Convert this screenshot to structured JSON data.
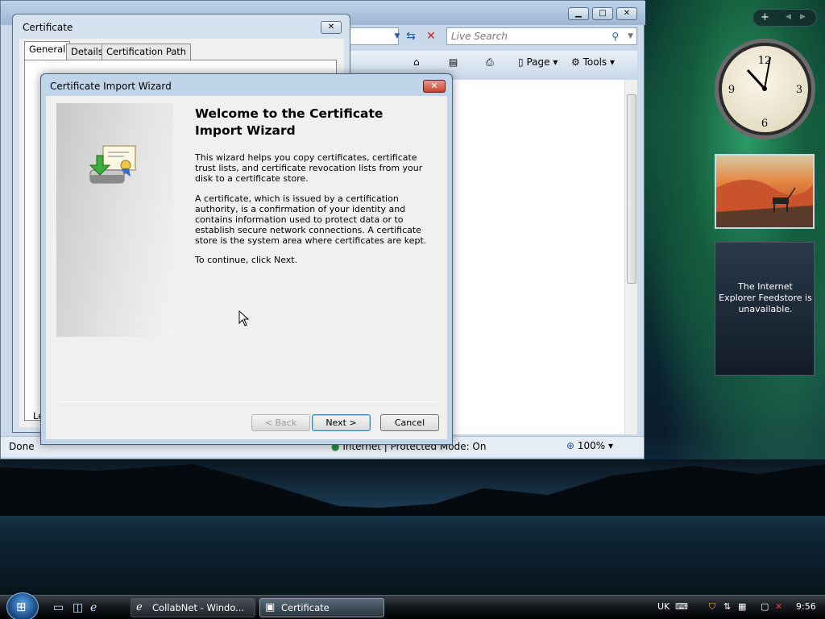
{
  "ie": {
    "search_placeholder": "Live Search",
    "cmd_page": "Page",
    "cmd_tools": "Tools",
    "status_done": "Done",
    "status_zone": "Internet | Protected Mode: On",
    "zoom": "100%"
  },
  "cert_dialog": {
    "title": "Certificate",
    "tabs": [
      "General",
      "Details",
      "Certification Path"
    ],
    "panel_text": "Le"
  },
  "wizard": {
    "title": "Certificate Import Wizard",
    "heading": "Welcome to the Certificate Import Wizard",
    "para1": "This wizard helps you copy certificates, certificate trust lists, and certificate revocation lists from your disk to a certificate store.",
    "para2": "A certificate, which is issued by a certification authority, is a confirmation of your identity and contains information used to protect data or to establish secure network connections. A certificate store is the system area where certificates are kept.",
    "para3": "To continue, click Next.",
    "back_label": "< Back",
    "next_label": "Next >",
    "cancel_label": "Cancel"
  },
  "gadgets": {
    "feed_text": "The Internet Explorer Feedstore is unavailable."
  },
  "taskbar": {
    "tasks": [
      "CollabNet - Windo...",
      "Certificate"
    ],
    "language": "UK",
    "clock": "9:56"
  },
  "icons": {
    "refresh": "refresh-icon",
    "stop": "stop-icon",
    "search": "search-icon",
    "home": "home-icon",
    "feeds": "rss-icon",
    "print": "print-icon",
    "page": "page-icon",
    "tools": "gear-icon",
    "zoom": "magnifier-icon"
  }
}
